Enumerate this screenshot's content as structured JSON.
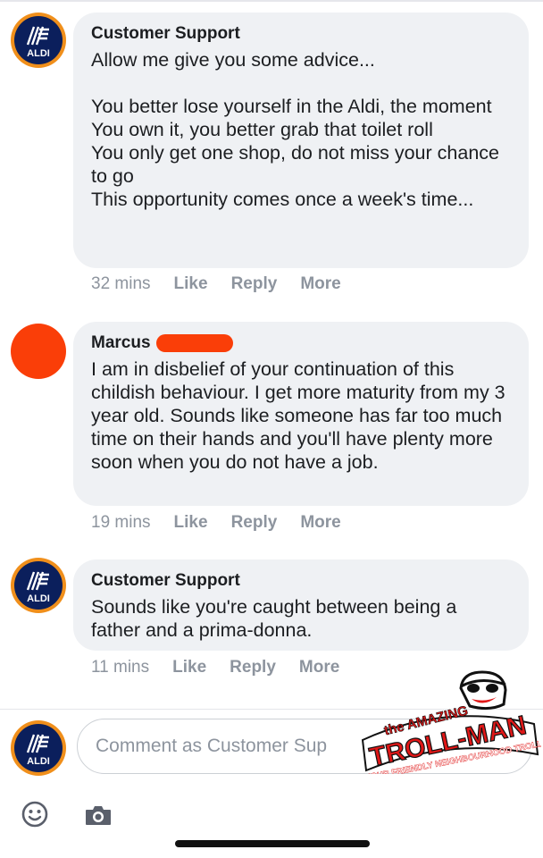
{
  "comments": [
    {
      "author": "Customer Support",
      "avatar_text": "ALDI",
      "text": "Allow me give you some advice...\n\nYou better lose yourself in the Aldi, the moment\nYou own it, you better grab that toilet roll\nYou only get one shop, do not miss your chance to go\nThis opportunity comes once a week's time...",
      "time": "32 mins",
      "like": "Like",
      "reply": "Reply",
      "more": "More"
    },
    {
      "author": "Marcus",
      "text": "I am in disbelief of your continuation of this childish behaviour. I get more maturity from my 3 year old. Sounds like someone has far too much time on their hands and you'll have plenty more soon when you do not have a job.",
      "time": "19 mins",
      "like": "Like",
      "reply": "Reply",
      "more": "More"
    },
    {
      "author": "Customer Support",
      "avatar_text": "ALDI",
      "text": "Sounds like you're caught between being a father and a prima-donna.",
      "time": "11 mins",
      "like": "Like",
      "reply": "Reply",
      "more": "More"
    }
  ],
  "composer": {
    "avatar_text": "ALDI",
    "placeholder": "Comment as Customer Sup"
  },
  "toolbar": {
    "emoji_icon": "smiley-icon",
    "camera_icon": "camera-icon"
  },
  "watermark": {
    "line1": "the AMAZING",
    "line2": "TROLL-MAN",
    "line3": "YOUR FRIENDLY NEIGHBOURHOOD TROLL"
  },
  "colors": {
    "aldi_ring": "#f08f1b",
    "aldi_blue": "#0b1f5c",
    "bubble": "#eff1f4",
    "redaction": "#fa3e08",
    "meta_text": "#8d949e"
  }
}
